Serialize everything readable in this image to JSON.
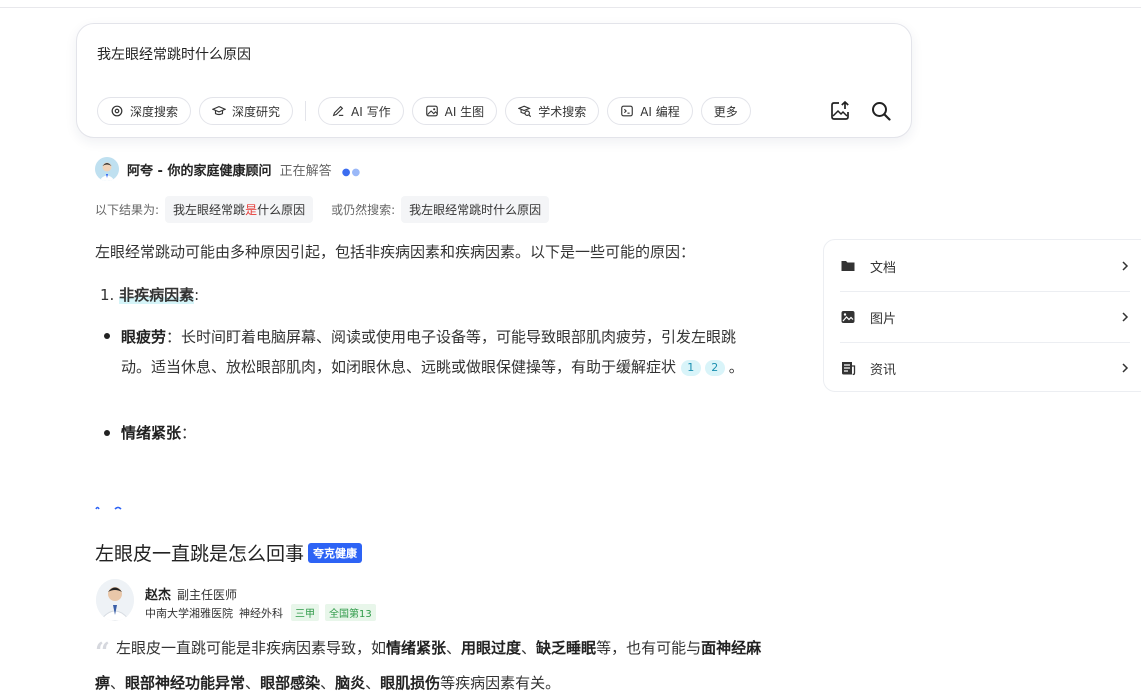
{
  "search": {
    "query": "我左眼经常跳时什么原因",
    "tools": [
      {
        "label": "深度搜索",
        "icon": "deep-search-icon"
      },
      {
        "label": "深度研究",
        "icon": "graduation-cap-icon"
      },
      {
        "label": "AI 写作",
        "icon": "pen-icon"
      },
      {
        "label": "AI 生图",
        "icon": "image-icon"
      },
      {
        "label": "学术搜索",
        "icon": "academic-search-icon"
      },
      {
        "label": "AI 编程",
        "icon": "terminal-icon"
      },
      {
        "label": "更多",
        "icon": ""
      }
    ]
  },
  "answer": {
    "assistant_name": "阿夸 - 你的家庭健康顾问",
    "status": "正在解答",
    "results_for_label": "以下结果为:",
    "results_for_query_pre": "我左眼经常跳",
    "results_for_query_hl": "是",
    "results_for_query_post": "什么原因",
    "still_search_label": "或仍然搜索:",
    "still_search_query": "我左眼经常跳时什么原因",
    "intro": "左眼经常跳动可能由多种原因引起，包括非疾病因素和疾病因素。以下是一些可能的原因：",
    "list_num": "1.",
    "list_title": "非疾病因素",
    "list_colon": ":",
    "item1_title": "眼疲劳",
    "item1_text": "：长时间盯着电脑屏幕、阅读或使用电子设备等，可能导致眼部肌肉疲劳，引发左眼跳动。适当休息、放松眼部肌肉，如闭眼休息、远眺或做眼保健操等，有助于缓解症状",
    "item1_cites": [
      "1",
      "2"
    ],
    "item1_end": "。",
    "item2_title": "情绪紧张",
    "item2_text": "："
  },
  "side_panel": {
    "items": [
      {
        "label": "文档",
        "icon": "folder-icon"
      },
      {
        "label": "图片",
        "icon": "image-icon"
      },
      {
        "label": "资讯",
        "icon": "news-icon"
      }
    ]
  },
  "doctor_card": {
    "title": "左眼皮一直跳是怎么回事",
    "badge": "夸克健康",
    "doctor_name": "赵杰",
    "doctor_title": "副主任医师",
    "hospital": "中南大学湘雅医院",
    "department": "神经外科",
    "tag1": "三甲",
    "tag2": "全国第13",
    "q_pre": "左眼皮一直跳可能是非疾病因素导致，如",
    "q_b1": "情绪紧张",
    "q_s1": "、",
    "q_b2": "用眼过度",
    "q_s2": "、",
    "q_b3": "缺乏睡眠",
    "q_mid": "等，也有可能与",
    "q_b4": "面神经麻痹",
    "q_s3": "、",
    "q_b5": "眼部神经功能异常",
    "q_s4": "、",
    "q_b6": "眼部感染",
    "q_s5": "、",
    "q_b7": "脑炎",
    "q_s6": "、",
    "q_b8": "眼肌损伤",
    "q_end": "等疾病因素有关。"
  },
  "colors": {
    "accent": "#2d63f5",
    "highlight": "#d5f4f8",
    "cite_bg": "#d9f4f9"
  }
}
